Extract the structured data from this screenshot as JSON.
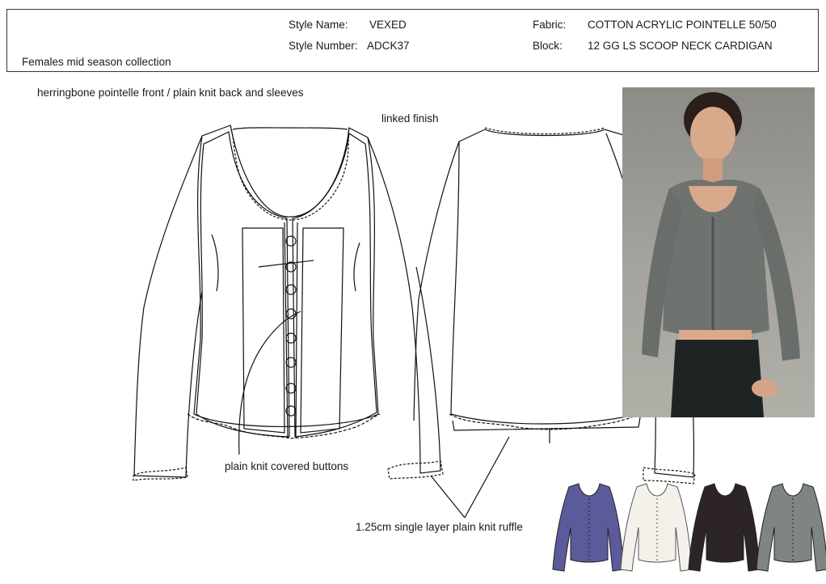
{
  "header": {
    "collection": "Females  mid season collection",
    "style_name_label": "Style Name:",
    "style_name_value": "VEXED",
    "style_number_label": "Style Number:",
    "style_number_value": "ADCK37",
    "fabric_label": "Fabric:",
    "fabric_value": "COTTON ACRYLIC POINTELLE 50/50",
    "block_label": "Block:",
    "block_value": "12 GG LS SCOOP NECK CARDIGAN"
  },
  "notes": {
    "description": "herringbone pointelle front / plain knit back and sleeves",
    "linked_finish": "linked finish",
    "buttons": "plain knit covered buttons",
    "ruffle": "1.25cm single layer plain knit ruffle"
  },
  "colorways": [
    "#5b5a9a",
    "#f3f1ea",
    "#2c2427",
    "#7f8580"
  ],
  "photo_colors": {
    "background": "#9e9d97",
    "garment": "#6f7370",
    "pants": "#1d2423",
    "skin": "#d9a98c",
    "hair": "#2a1f1a"
  }
}
